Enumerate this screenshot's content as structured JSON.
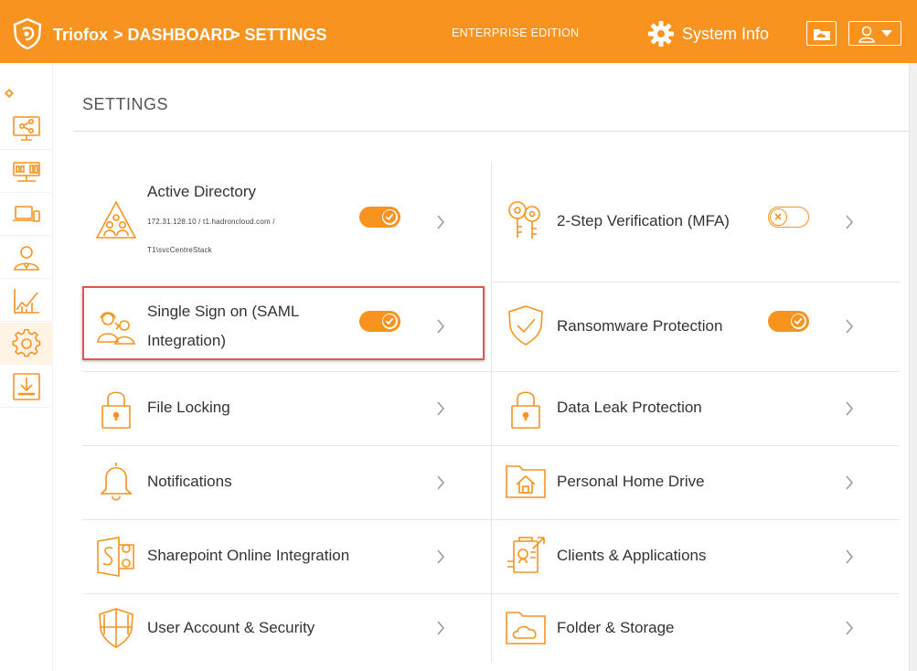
{
  "header": {
    "brand": "Triofox",
    "breadcrumb": [
      "> DASHBOARD",
      "> SETTINGS"
    ],
    "edition": "ENTERPRISE EDITION",
    "system_info_label": "System Info",
    "accent_color": "#f7931e"
  },
  "sidebar": {
    "items": [
      {
        "icon": "share-icon",
        "active": false
      },
      {
        "icon": "server-icon",
        "active": false
      },
      {
        "icon": "devices-icon",
        "active": false
      },
      {
        "icon": "users-icon",
        "active": false
      },
      {
        "icon": "chart-icon",
        "active": false
      },
      {
        "icon": "gear-icon",
        "active": true
      },
      {
        "icon": "download-icon",
        "active": false
      }
    ]
  },
  "page": {
    "title": "SETTINGS"
  },
  "settings": {
    "active_directory": {
      "label": "Active Directory",
      "detail_line1": "172.31.128.10 / t1.hadroncloud.com /",
      "detail_line2": "T1\\svcCentreStack",
      "enabled": true
    },
    "mfa": {
      "label": "2-Step Verification (MFA)",
      "enabled": false
    },
    "sso": {
      "label_line1": "Single Sign on (SAML",
      "label_line2": "Integration)",
      "enabled": true,
      "highlighted": true
    },
    "ransomware": {
      "label": "Ransomware Protection",
      "enabled": true
    },
    "file_locking": {
      "label": "File Locking"
    },
    "data_leak": {
      "label": "Data Leak Protection"
    },
    "notifications": {
      "label": "Notifications"
    },
    "home_drive": {
      "label": "Personal Home Drive"
    },
    "sharepoint": {
      "label": "Sharepoint Online Integration"
    },
    "clients": {
      "label": "Clients & Applications"
    },
    "user_account": {
      "label": "User Account & Security"
    },
    "folder_storage": {
      "label": "Folder & Storage"
    }
  }
}
